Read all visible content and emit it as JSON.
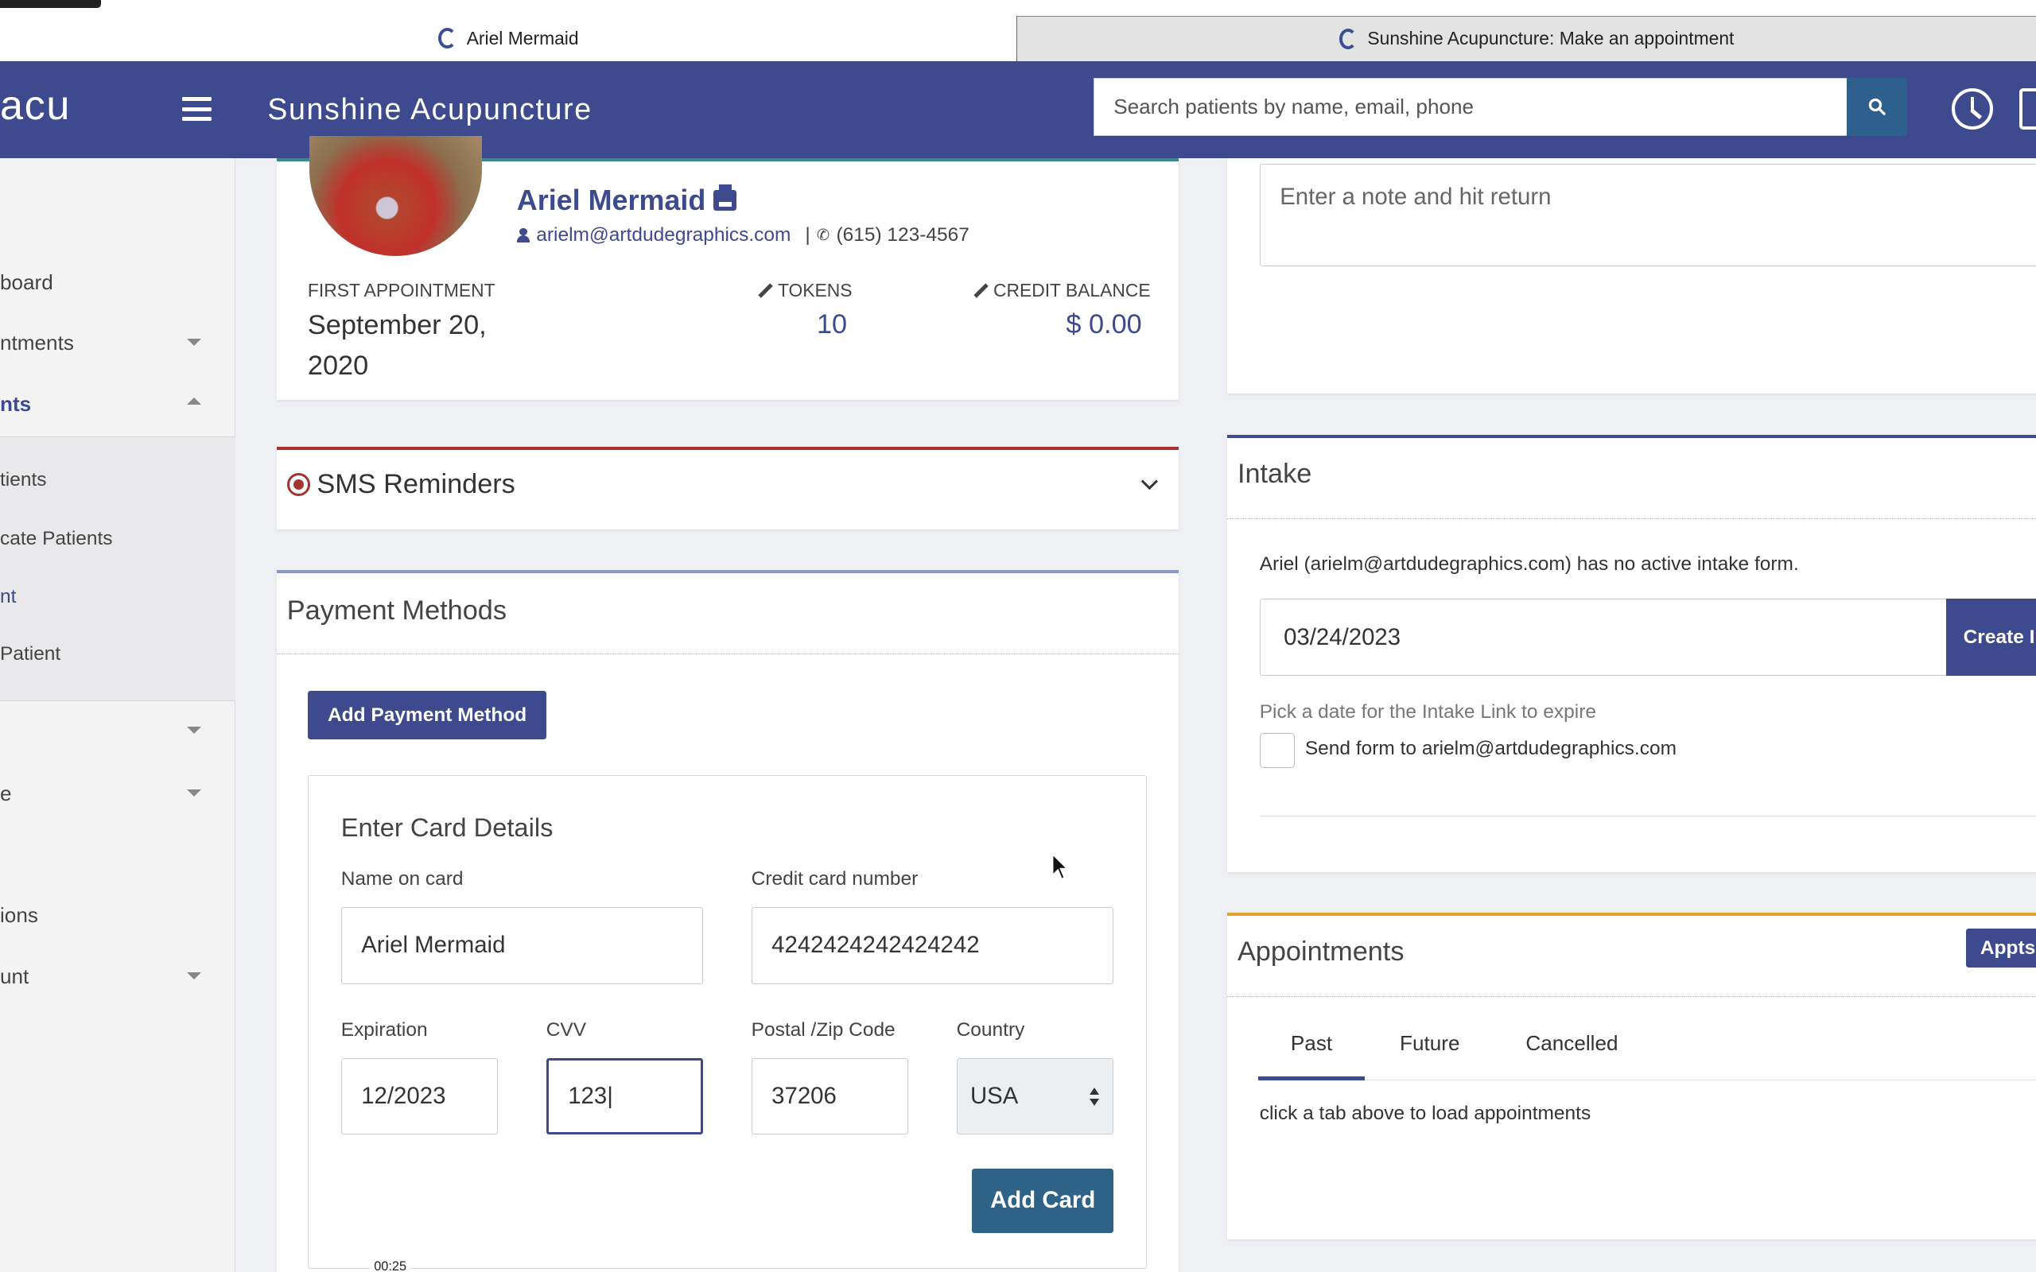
{
  "browser": {
    "tabs": [
      {
        "title": "Ariel Mermaid",
        "active": true
      },
      {
        "title": "Sunshine Acupuncture: Make an appointment",
        "active": false
      }
    ]
  },
  "header": {
    "brand": "acu",
    "title": "Sunshine Acupuncture",
    "search_placeholder": "Search patients by name, email, phone",
    "colors": {
      "bar": "#3d4b8e",
      "search_button": "#2f5f8c"
    }
  },
  "sidebar": {
    "items": [
      {
        "label": "board",
        "has_caret": false
      },
      {
        "label": "ntments",
        "has_caret": "down"
      },
      {
        "label": "nts",
        "has_caret": "up",
        "active": true
      }
    ],
    "submenu": [
      {
        "label": "tients"
      },
      {
        "label": "cate Patients"
      },
      {
        "label": "nt",
        "active": true
      },
      {
        "label": "Patient"
      }
    ],
    "lower_items": [
      {
        "label": "",
        "has_caret": "down"
      },
      {
        "label": "e",
        "has_caret": "down"
      },
      {
        "label": "ions",
        "has_caret": false
      },
      {
        "label": "unt",
        "has_caret": "down"
      }
    ]
  },
  "patient": {
    "name": "Ariel Mermaid",
    "email": "arielm@artdudegraphics.com",
    "separator": "|",
    "phone": "(615) 123-4567",
    "first_appointment_label": "FIRST APPOINTMENT",
    "first_appointment_value": "September 20, 2020",
    "tokens_label": "TOKENS",
    "tokens_value": "10",
    "credit_label": "CREDIT BALANCE",
    "credit_value": "$ 0.00"
  },
  "sms": {
    "title": "SMS Reminders"
  },
  "payment": {
    "title": "Payment Methods",
    "add_button": "Add Payment Method",
    "card_details_title": "Enter Card Details",
    "fields": {
      "name_label": "Name on card",
      "name_value": "Ariel Mermaid",
      "number_label": "Credit card number",
      "number_value": "4242424242424242",
      "expiration_label": "Expiration",
      "expiration_value": "12/2023",
      "cvv_label": "CVV",
      "cvv_value": "123|",
      "postal_label": "Postal /Zip Code",
      "postal_value": "37206",
      "country_label": "Country",
      "country_value": "USA"
    },
    "add_card_button": "Add Card",
    "timestamp": "00:25"
  },
  "notes": {
    "placeholder": "Enter a note and hit return"
  },
  "intake": {
    "title": "Intake",
    "message": "Ariel (arielm@artdudegraphics.com) has no active intake form.",
    "date_value": "03/24/2023",
    "create_button": "Create I",
    "hint": "Pick a date for the Intake Link to expire",
    "send_label": "Send form to arielm@artdudegraphics.com"
  },
  "appointments": {
    "title": "Appointments",
    "appts_button": "Appts",
    "tabs": [
      "Past",
      "Future",
      "Cancelled"
    ],
    "active_tab": "Past",
    "message": "click a tab above to load appointments"
  }
}
